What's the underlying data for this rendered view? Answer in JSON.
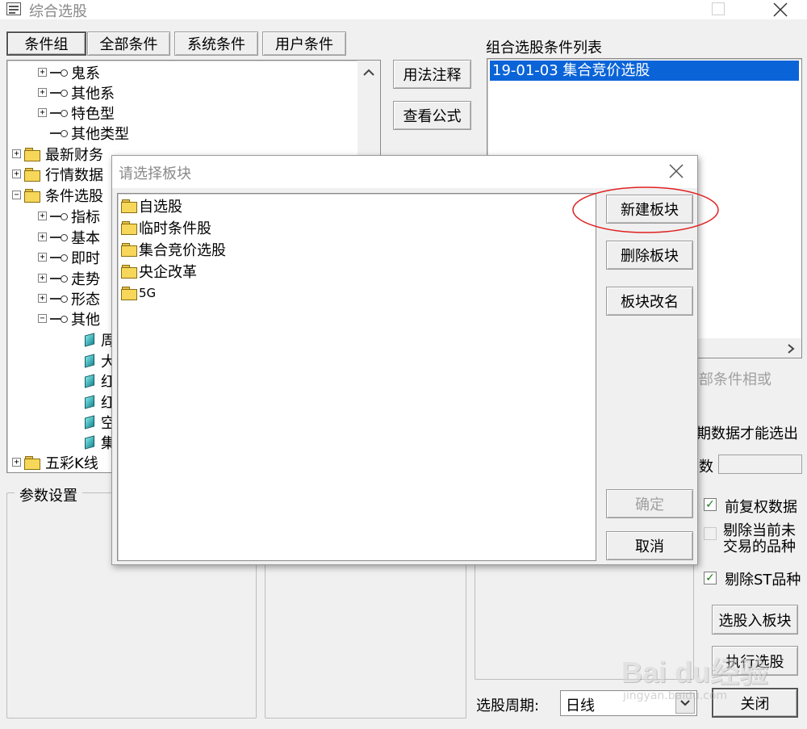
{
  "window": {
    "title": "综合选股"
  },
  "tabs": [
    {
      "label": "条件组"
    },
    {
      "label": "全部条件"
    },
    {
      "label": "系统条件"
    },
    {
      "label": "用户条件"
    }
  ],
  "tree": {
    "items": [
      {
        "label": "鬼系"
      },
      {
        "label": "其他系"
      },
      {
        "label": "特色型"
      },
      {
        "label": "其他类型"
      },
      {
        "label": "最新财务"
      },
      {
        "label": "行情数据"
      },
      {
        "label": "条件选股"
      },
      {
        "label": "指标"
      },
      {
        "label": "基本"
      },
      {
        "label": "即时"
      },
      {
        "label": "走势"
      },
      {
        "label": "形态"
      },
      {
        "label": "其他"
      },
      {
        "label": "周"
      },
      {
        "label": "大"
      },
      {
        "label": "红"
      },
      {
        "label": "红"
      },
      {
        "label": "空"
      },
      {
        "label": "集"
      },
      {
        "label": "五彩K线"
      }
    ]
  },
  "middle_buttons": {
    "usage": "用法注释",
    "formula": "查看公式"
  },
  "condition_list": {
    "title": "组合选股条件列表",
    "items": [
      {
        "label": "19-01-03 集合竞价选股"
      }
    ]
  },
  "right_panel": {
    "partial_all_or": "部条件相或",
    "partial_data_note": "期数据才能选出",
    "partial_count": "数",
    "cb_pre_restore": "前复权数据",
    "cb_exclude_untraded": "剔除当前未交易的品种",
    "cb_exclude_st": "剔除ST品种",
    "btn_to_block": "选股入板块",
    "btn_execute": "执行选股",
    "btn_close": "关闭",
    "period_label": "选股周期:",
    "period_value": "日线"
  },
  "params": {
    "title": "参数设置"
  },
  "dialog": {
    "title": "请选择板块",
    "blocks": [
      {
        "label": "自选股"
      },
      {
        "label": "临时条件股"
      },
      {
        "label": "集合竞价选股"
      },
      {
        "label": "央企改革"
      },
      {
        "label": "5G"
      }
    ],
    "new_block": "新建板块",
    "delete_block": "删除板块",
    "rename_block": "板块改名",
    "confirm": "确定",
    "cancel": "取消"
  },
  "watermark": {
    "brand": "Bai du经验",
    "url": "jingyan.baidu.com"
  },
  "colors": {
    "selection": "#0a64d8",
    "annotation": "#e02020"
  }
}
